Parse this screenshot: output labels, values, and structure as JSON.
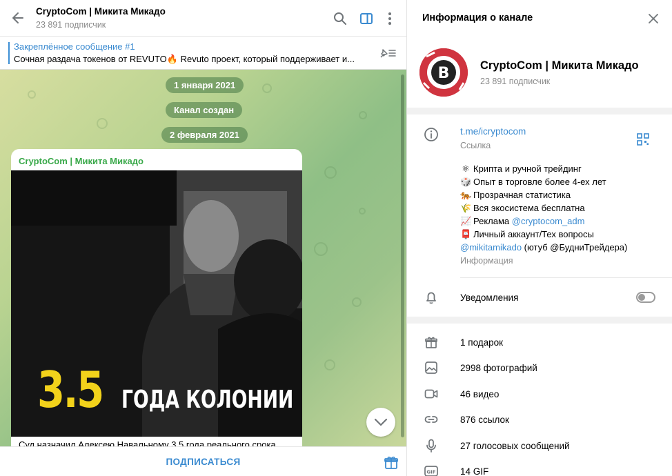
{
  "chat": {
    "title": "CryptoCom | Микита Микадо",
    "subscribers": "23 891 подписчик",
    "pinned": {
      "title": "Закреплённое сообщение #1",
      "text": "Сочная раздача  токенов от REVUTO🔥 Revuto проект, который поддерживает и..."
    },
    "dates": [
      "1 января 2021",
      "Канал создан",
      "2 февраля 2021"
    ],
    "post": {
      "author": "CryptoCom | Микита Микадо",
      "image_big": "3.5",
      "image_text": "ГОДА КОЛОНИИ",
      "caption": "Суд назначил Алексею Навальному 3,5 года реального срока"
    },
    "subscribe_label": "ПОДПИСАТЬСЯ"
  },
  "info": {
    "panel_title": "Информация о канале",
    "channel_name": "CryptoCom | Микита Микадо",
    "subscribers": "23 891 подписчик",
    "link": "t.me/icryptocom",
    "link_label": "Ссылка",
    "bio": [
      {
        "emoji": "⚛",
        "text": "Крипта и ручной трейдинг"
      },
      {
        "emoji": "🎲",
        "text": "Опыт в торговле более 4-ех лет"
      },
      {
        "emoji": "🐅",
        "text": "Прозрачная статистика"
      },
      {
        "emoji": "🌾",
        "text": "Вся экосистема бесплатна"
      },
      {
        "emoji": "📈",
        "text": "Реклама ",
        "link": "@cryptocom_adm"
      },
      {
        "emoji": "📮",
        "text": "Личный аккаунт/Тех вопросы"
      }
    ],
    "bio_last_link": "@mikitamikado",
    "bio_last_text": " (ютуб @БудниТрейдера)",
    "bio_label": "Информация",
    "notifications_label": "Уведомления",
    "notifications_on": false,
    "media": [
      {
        "icon": "gift-icon",
        "label": "1 подарок"
      },
      {
        "icon": "photo-icon",
        "label": "2998 фотографий"
      },
      {
        "icon": "video-icon",
        "label": "46 видео"
      },
      {
        "icon": "link-icon",
        "label": "876 ссылок"
      },
      {
        "icon": "microphone-icon",
        "label": "27 голосовых сообщений"
      },
      {
        "icon": "gif-icon",
        "label": "14 GIF"
      }
    ]
  },
  "colors": {
    "accent": "#3a8ad0",
    "author_green": "#3aa94a",
    "image_yellow": "#f2d21b"
  }
}
